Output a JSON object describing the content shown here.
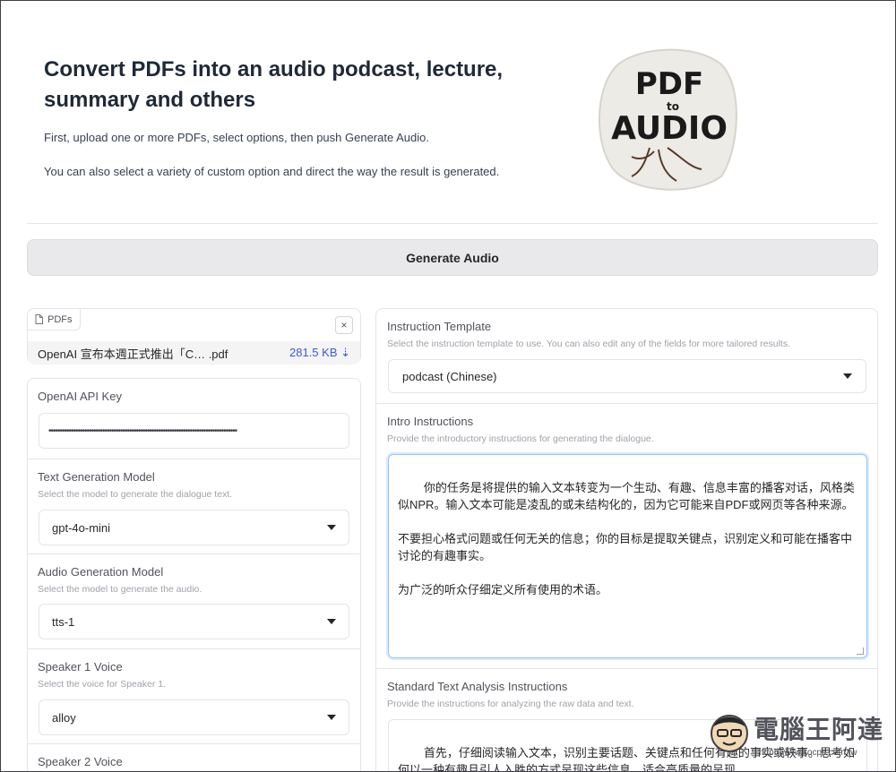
{
  "header": {
    "title": "Convert PDFs into an audio podcast, lecture, summary and others",
    "desc1": "First, upload one or more PDFs, select options, then push Generate Audio.",
    "desc2": "You can also select a variety of custom option and direct the way the result is generated.",
    "logo": {
      "line1": "PDF",
      "line2": "to",
      "line3": "AUDIO"
    }
  },
  "generate_button": "Generate Audio",
  "pdfs": {
    "tag": "PDFs",
    "close": "×",
    "file_name": "OpenAI 宣布本週正式推出「C…  .pdf",
    "file_size": "281.5 KB ⇣"
  },
  "left": {
    "api_key": {
      "label": "OpenAI API Key",
      "value": "••••••••••••••••••••••••••••••••••••••••••••••••••••••••••••••••••••••••••••••••••••"
    },
    "text_model": {
      "label": "Text Generation Model",
      "sub": "Select the model to generate the dialogue text.",
      "value": "gpt-4o-mini"
    },
    "audio_model": {
      "label": "Audio Generation Model",
      "sub": "Select the model to generate the audio.",
      "value": "tts-1"
    },
    "speaker1": {
      "label": "Speaker 1 Voice",
      "sub": "Select the voice for Speaker 1.",
      "value": "alloy"
    },
    "speaker2": {
      "label": "Speaker 2 Voice"
    }
  },
  "right": {
    "template": {
      "label": "Instruction Template",
      "sub": "Select the instruction template to use. You can also edit any of the fields for more tailored results.",
      "value": "podcast (Chinese)"
    },
    "intro": {
      "label": "Intro Instructions",
      "sub": "Provide the introductory instructions for generating the dialogue.",
      "text": "你的任务是将提供的输入文本转变为一个生动、有趣、信息丰富的播客对话，风格类似NPR。输入文本可能是凌乱的或未结构化的，因为它可能来自PDF或网页等各种来源。\n\n不要担心格式问题或任何无关的信息；你的目标是提取关键点，识别定义和可能在播客中讨论的有趣事实。\n\n为广泛的听众仔细定义所有使用的术语。"
    },
    "analysis": {
      "label": "Standard Text Analysis Instructions",
      "sub": "Provide the instructions for analyzing the raw data and text.",
      "text": "首先，仔细阅读输入文本，识别主要话题、关键点和任何有趣的事实或轶事。思考如何以一种有趣且引人入胜的方式呈现这些信息，适合高质量的呈现。"
    }
  },
  "watermark": {
    "text": "電腦王阿達",
    "url": "http://www.kocpc.com.tw"
  },
  "colors": {
    "accent_border": "#93c5fd",
    "link": "#3b5bdb"
  }
}
